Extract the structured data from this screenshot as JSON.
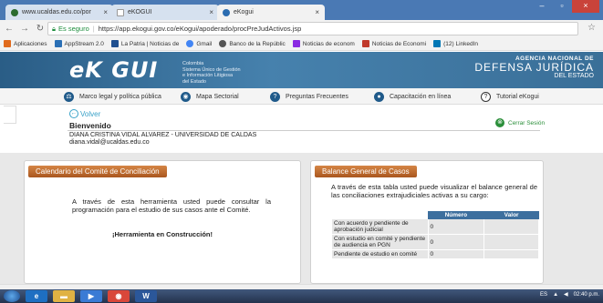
{
  "browser": {
    "tabs": [
      {
        "label": "www.ucaldas.edu.co/por",
        "active": false
      },
      {
        "label": "eKOGUI",
        "active": false
      },
      {
        "label": "eKogui",
        "active": true
      }
    ],
    "secure_label": "Es seguro",
    "url": "https://app.ekogui.gov.co/eKogui/apoderado/procPreJudActivos.jsp",
    "bookmarks": [
      {
        "label": "Aplicaciones",
        "icon": "apps-icon",
        "color": "#e06a1c"
      },
      {
        "label": "AppStream 2.0",
        "icon": "appstream-icon",
        "color": "#2a6fb5"
      },
      {
        "label": "La Patria | Noticias de",
        "icon": "lapatria-icon",
        "color": "#1f4f8f"
      },
      {
        "label": "Gmail",
        "icon": "google-icon",
        "color": "#4285f4"
      },
      {
        "label": "Banco de la Repúblic",
        "icon": "banco-icon",
        "color": "#555555"
      },
      {
        "label": "Noticias de econom",
        "icon": "p-icon",
        "color": "#8a2be2"
      },
      {
        "label": "Noticias de Economi",
        "icon": "news-icon",
        "color": "#c0392b"
      },
      {
        "label": "(12) LinkedIn",
        "icon": "linkedin-icon",
        "color": "#0077b5"
      }
    ]
  },
  "header": {
    "logo": "eK GUI",
    "logo_sub": [
      "Colombia",
      "Sistema Único de Gestión",
      "e Información Litigiosa",
      "del Estado"
    ],
    "agency_line1": "AGENCIA NACIONAL DE",
    "agency_line2": "DEFENSA JURÍDICA",
    "agency_line3": "DEL ESTADO"
  },
  "menu": [
    {
      "label": "Marco legal y política pública",
      "icon": "scale-icon"
    },
    {
      "label": "Mapa Sectorial",
      "icon": "map-icon"
    },
    {
      "label": "Preguntas Frecuentes",
      "icon": "faq-icon"
    },
    {
      "label": "Capacitación en línea",
      "icon": "training-icon"
    },
    {
      "label": "Tutorial eKogui",
      "icon": "help-icon"
    }
  ],
  "page": {
    "back_label": "Volver",
    "welcome": "Bienvenido",
    "logout_label": "Cerrar Sesión",
    "user_name": "DIANA CRISTINA VIDAL ALVAREZ - UNIVERSIDAD DE CALDAS",
    "user_email": "diana.vidal@ucaldas.edu.co"
  },
  "panels": {
    "calendar": {
      "title": "Calendario del Comité de Conciliación",
      "text": "A través de esta herramienta usted puede consultar la programación para el estudio de sus casos ante el Comité.",
      "status": "¡Herramienta en Construcción!"
    },
    "balance": {
      "title": "Balance General de Casos",
      "text": "A través de esta tabla usted puede visualizar el balance general de las conciliaciones extrajudiciales activas a su cargo:",
      "columns": [
        "Número",
        "Valor"
      ],
      "rows": [
        {
          "label": "Con acuerdo y pendiente de aprobación judicial",
          "number": "0",
          "value": ""
        },
        {
          "label": "Con estudio en comité y pendiente de audiencia en PGN",
          "number": "0",
          "value": ""
        },
        {
          "label": "Pendiente de estudio en comité",
          "number": "0",
          "value": ""
        }
      ]
    }
  },
  "taskbar": {
    "lang": "ES",
    "time": "02:40 p.m."
  }
}
